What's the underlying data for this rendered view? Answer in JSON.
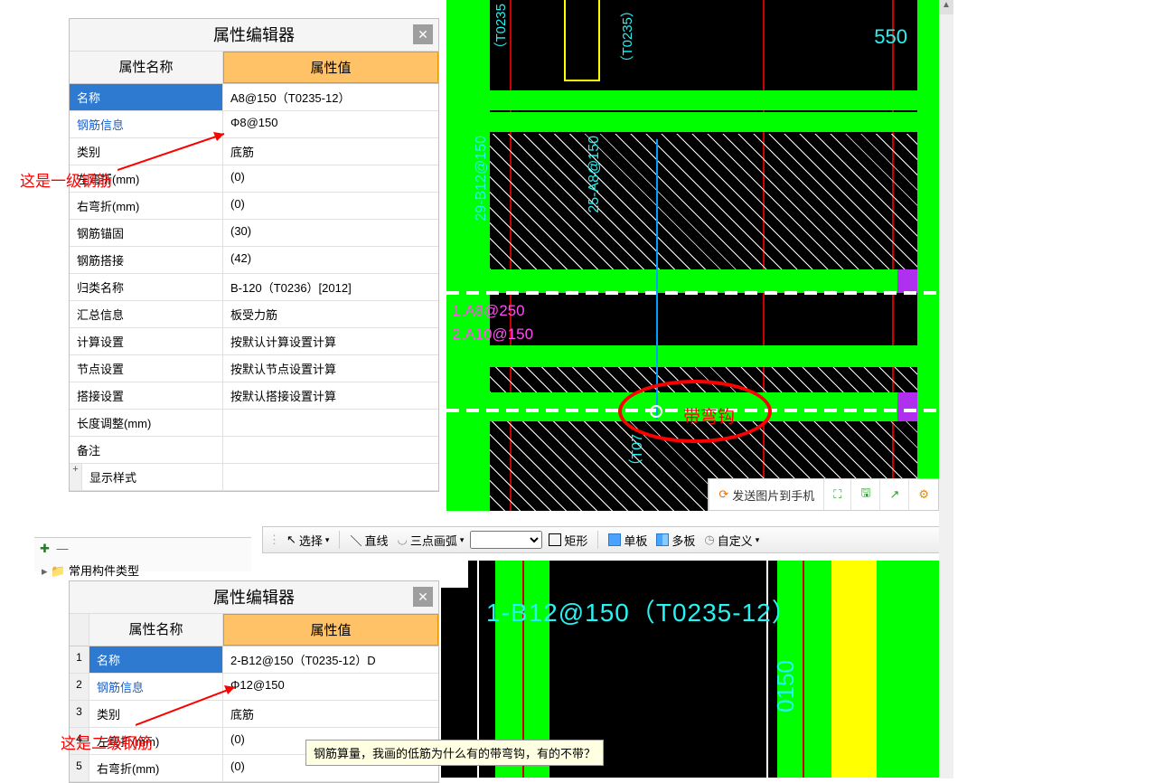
{
  "panel1": {
    "title": "属性编辑器",
    "header": {
      "name": "属性名称",
      "value": "属性值"
    },
    "rows": [
      {
        "name": "名称",
        "value": "A8@150（T0235-12）",
        "selected": true
      },
      {
        "name": "钢筋信息",
        "value": "Φ8@150",
        "link": true
      },
      {
        "name": "类别",
        "value": "底筋"
      },
      {
        "name": "左弯折(mm)",
        "value": "(0)"
      },
      {
        "name": "右弯折(mm)",
        "value": "(0)"
      },
      {
        "name": "钢筋锚固",
        "value": "(30)"
      },
      {
        "name": "钢筋搭接",
        "value": "(42)"
      },
      {
        "name": "归类名称",
        "value": "B-120（T0236）[2012]"
      },
      {
        "name": "汇总信息",
        "value": "板受力筋"
      },
      {
        "name": "计算设置",
        "value": "按默认计算设置计算"
      },
      {
        "name": "节点设置",
        "value": "按默认节点设置计算"
      },
      {
        "name": "搭接设置",
        "value": "按默认搭接设置计算"
      },
      {
        "name": "长度调整(mm)",
        "value": ""
      },
      {
        "name": "备注",
        "value": ""
      },
      {
        "name": "显示样式",
        "value": "",
        "expander": true
      }
    ]
  },
  "annotation1": "这是一级钢筋",
  "annotation2": "这是二级钢筋",
  "cad1": {
    "label_550": "550",
    "label_t0235_1": "（T0235",
    "label_t0235_2": "（T0235）",
    "label_b12": "29-B12@150",
    "label_a8": "25-A8@150",
    "label_mag1": "1.A8@250",
    "label_mag2": "2.A10@150",
    "label_to7": "（T07",
    "red_label": "带弯钩"
  },
  "floatbar": {
    "send": "发送图片到手机"
  },
  "tree": {
    "label": "常用构件类型"
  },
  "toolbar2": {
    "select": "选择",
    "line": "直线",
    "arc": "三点画弧",
    "rect": "矩形",
    "single": "单板",
    "multi": "多板",
    "custom": "自定义"
  },
  "cad2": {
    "text": "1-B12@150（T0235-12）",
    "vtext": "0150"
  },
  "panel2": {
    "title": "属性编辑器",
    "header": {
      "name": "属性名称",
      "value": "属性值"
    },
    "rows": [
      {
        "n": "1",
        "name": "名称",
        "value": "2-B12@150（T0235-12）D",
        "selected": true
      },
      {
        "n": "2",
        "name": "钢筋信息",
        "value": "Φ12@150",
        "link": true
      },
      {
        "n": "3",
        "name": "类别",
        "value": "底筋"
      },
      {
        "n": "4",
        "name": "左弯折(mm)",
        "value": "(0)"
      },
      {
        "n": "5",
        "name": "右弯折(mm)",
        "value": "(0)"
      }
    ]
  },
  "tooltip": "钢筋算量，我画的低筋为什么有的带弯钩，有的不带？"
}
